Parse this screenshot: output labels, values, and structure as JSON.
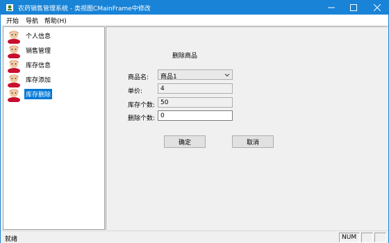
{
  "window": {
    "title": "农药销售管理系统 - 类视图CMainFrame中修改"
  },
  "menu": [
    "开始",
    "导航",
    "帮助(H)"
  ],
  "sidebar": {
    "items": [
      {
        "label": "个人信息",
        "selected": false
      },
      {
        "label": "销售管理",
        "selected": false
      },
      {
        "label": "库存信息",
        "selected": false
      },
      {
        "label": "库存添加",
        "selected": false
      },
      {
        "label": "库存删除",
        "selected": true
      }
    ]
  },
  "form": {
    "title": "删除商品",
    "product_label": "商品名:",
    "product_value": "商品1",
    "price_label": "单价:",
    "price_value": "4",
    "stock_label": "库存个数:",
    "stock_value": "50",
    "delete_label": "删除个数:",
    "delete_value": "0",
    "ok_label": "确定",
    "cancel_label": "取消"
  },
  "status": {
    "text": "就绪",
    "num": "NUM"
  },
  "colors": {
    "titlebar": "#1883d7",
    "selection": "#0078d7"
  }
}
